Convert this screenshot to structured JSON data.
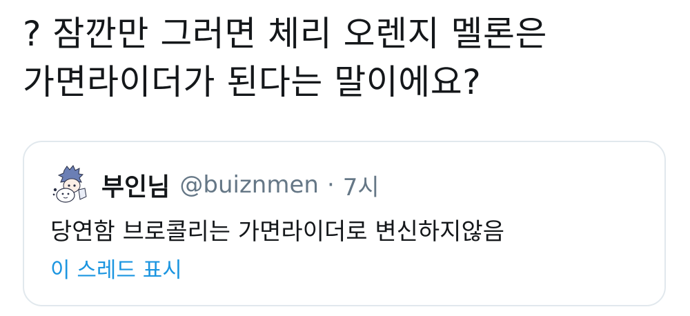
{
  "tweet": {
    "text_line1": "? 잠깐만 그러면 체리 오렌지 멜론은",
    "text_line2": "가면라이더가 된다는 말이에요?"
  },
  "quoted_tweet": {
    "author_name": "부인님",
    "author_handle": "@buiznmen",
    "separator": "·",
    "timestamp": "7시",
    "text": "당연함 브로콜리는 가면라이더로 변신하지않음",
    "show_thread_label": "이 스레드 표시",
    "avatar_icon": "cartoon-avatar-icon"
  },
  "colors": {
    "text": "#14171a",
    "secondary": "#657786",
    "link": "#1b95e0",
    "border": "#e1e8ed"
  }
}
